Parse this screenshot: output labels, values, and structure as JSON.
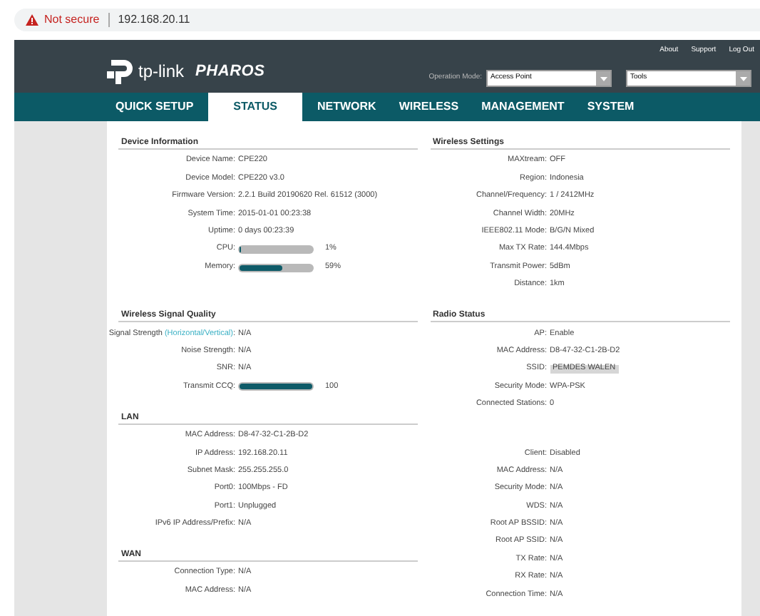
{
  "browser": {
    "security": "Not secure",
    "url": "192.168.20.11"
  },
  "header": {
    "logo": "tp-link",
    "product": "PHAROS",
    "links": [
      "About",
      "Support",
      "Log Out"
    ],
    "mode_label": "Operation Mode:",
    "mode_value": "Access Point",
    "tools_value": "Tools"
  },
  "nav": [
    {
      "label": "QUICK SETUP",
      "selected": false
    },
    {
      "label": "STATUS",
      "selected": true
    },
    {
      "label": "NETWORK",
      "selected": false
    },
    {
      "label": "WIRELESS",
      "selected": false
    },
    {
      "label": "MANAGEMENT",
      "selected": false
    },
    {
      "label": "SYSTEM",
      "selected": false
    }
  ],
  "left_column": [
    {
      "title": "Device Information",
      "rows": [
        {
          "kind": "text",
          "label": "Device Name:",
          "value": "CPE220"
        },
        {
          "kind": "text",
          "label": "Device Model:",
          "value": "CPE220 v3.0"
        },
        {
          "kind": "text",
          "label": "Firmware Version:",
          "value": "2.2.1 Build 20190620 Rel. 61512 (3000)"
        },
        {
          "kind": "text",
          "label": "System Time:",
          "value": "2015-01-01 00:23:38"
        },
        {
          "kind": "text",
          "label": "Uptime:",
          "value": "0 days 00:23:39"
        },
        {
          "kind": "bar",
          "label": "CPU:",
          "level": 0.01,
          "value": "1%"
        },
        {
          "kind": "bar",
          "label": "Memory:",
          "level": 0.59,
          "value": "59%"
        }
      ]
    },
    {
      "title": "Wireless Signal Quality",
      "rows": [
        {
          "kind": "text",
          "label": "Signal Strength",
          "label_link": "(Horizontal/Vertical)",
          "label_suffix": ":",
          "value": "N/A"
        },
        {
          "kind": "text",
          "label": "Noise Strength:",
          "value": "N/A"
        },
        {
          "kind": "text",
          "label": "SNR:",
          "value": "N/A"
        },
        {
          "kind": "bar",
          "label": "Transmit CCQ:",
          "level": 1,
          "value": "100"
        }
      ]
    },
    {
      "title": "LAN",
      "rows": [
        {
          "kind": "text",
          "label": "MAC Address:",
          "value": "D8-47-32-C1-2B-D2"
        },
        {
          "kind": "text",
          "label": "IP Address:",
          "value": "192.168.20.11"
        },
        {
          "kind": "text",
          "label": "Subnet Mask:",
          "value": "255.255.255.0"
        },
        {
          "kind": "text",
          "label": "Port0:",
          "value": "100Mbps - FD"
        },
        {
          "kind": "text",
          "label": "Port1:",
          "value": "Unplugged"
        },
        {
          "kind": "text",
          "label": "IPv6 IP Address/Prefix:",
          "value": "N/A"
        }
      ]
    },
    {
      "title": "WAN",
      "rows": [
        {
          "kind": "text",
          "label": "Connection Type:",
          "value": "N/A"
        },
        {
          "kind": "text",
          "label": "MAC Address:",
          "value": "N/A"
        }
      ]
    }
  ],
  "right_column": [
    {
      "title": "Wireless Settings",
      "rows": [
        {
          "kind": "text",
          "label": "MAXtream:",
          "value": "OFF"
        },
        {
          "kind": "text",
          "label": "Region:",
          "value": "Indonesia"
        },
        {
          "kind": "text",
          "label": "Channel/Frequency:",
          "value": "1 / 2412MHz"
        },
        {
          "kind": "text",
          "label": "Channel Width:",
          "value": "20MHz"
        },
        {
          "kind": "text",
          "label": "IEEE802.11 Mode:",
          "value": "B/G/N Mixed"
        },
        {
          "kind": "text",
          "label": "Max TX Rate:",
          "value": "144.4Mbps"
        },
        {
          "kind": "text",
          "label": "Transmit Power:",
          "value": "5dBm"
        },
        {
          "kind": "text",
          "label": "Distance:",
          "value": "1km"
        }
      ]
    },
    {
      "title": "Radio Status",
      "rows": [
        {
          "kind": "text",
          "label": "AP:",
          "value": "Enable"
        },
        {
          "kind": "text",
          "label": "MAC Address:",
          "value": "D8-47-32-C1-2B-D2"
        },
        {
          "kind": "highlight",
          "label": "SSID:",
          "value": "PEMDES WALEN"
        },
        {
          "kind": "text",
          "label": "Security Mode:",
          "value": "WPA-PSK"
        },
        {
          "kind": "text",
          "label": "Connected Stations:",
          "value": "0"
        }
      ]
    },
    {
      "rows": [
        {
          "kind": "text",
          "label": "Client:",
          "value": "Disabled"
        },
        {
          "kind": "text",
          "label": "MAC Address:",
          "value": "N/A"
        },
        {
          "kind": "text",
          "label": "Security Mode:",
          "value": "N/A"
        },
        {
          "kind": "text",
          "label": "WDS:",
          "value": "N/A"
        },
        {
          "kind": "text",
          "label": "Root AP BSSID:",
          "value": "N/A"
        },
        {
          "kind": "text",
          "label": "Root AP SSID:",
          "value": "N/A"
        },
        {
          "kind": "text",
          "label": "TX Rate:",
          "value": "N/A"
        },
        {
          "kind": "text",
          "label": "RX Rate:",
          "value": "N/A"
        },
        {
          "kind": "text",
          "label": "Connection Time:",
          "value": "N/A"
        }
      ]
    }
  ]
}
